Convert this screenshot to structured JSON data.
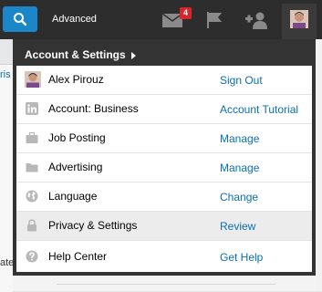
{
  "topbar": {
    "advanced_label": "Advanced",
    "messages_badge": "4"
  },
  "background": {
    "left_text_1": "ris",
    "left_text_2": "ate"
  },
  "dropdown": {
    "header": "Account & Settings",
    "rows": [
      {
        "label": "Alex Pirouz",
        "action": "Sign Out",
        "icon": "avatar"
      },
      {
        "label": "Account: Business",
        "action": "Account Tutorial",
        "icon": "linkedin-icon"
      },
      {
        "label": "Job Posting",
        "action": "Manage",
        "icon": "briefcase-icon"
      },
      {
        "label": "Advertising",
        "action": "Manage",
        "icon": "folder-icon"
      },
      {
        "label": "Language",
        "action": "Change",
        "icon": "globe-icon"
      },
      {
        "label": "Privacy & Settings",
        "action": "Review",
        "icon": "lock-icon"
      },
      {
        "label": "Help Center",
        "action": "Get Help",
        "icon": "help-icon"
      }
    ]
  },
  "colors": {
    "topbar": "#2d2d2d",
    "search_button": "#1b86c8",
    "badge": "#d8242a",
    "link": "#0b6fb0",
    "dropdown": "#333333"
  }
}
